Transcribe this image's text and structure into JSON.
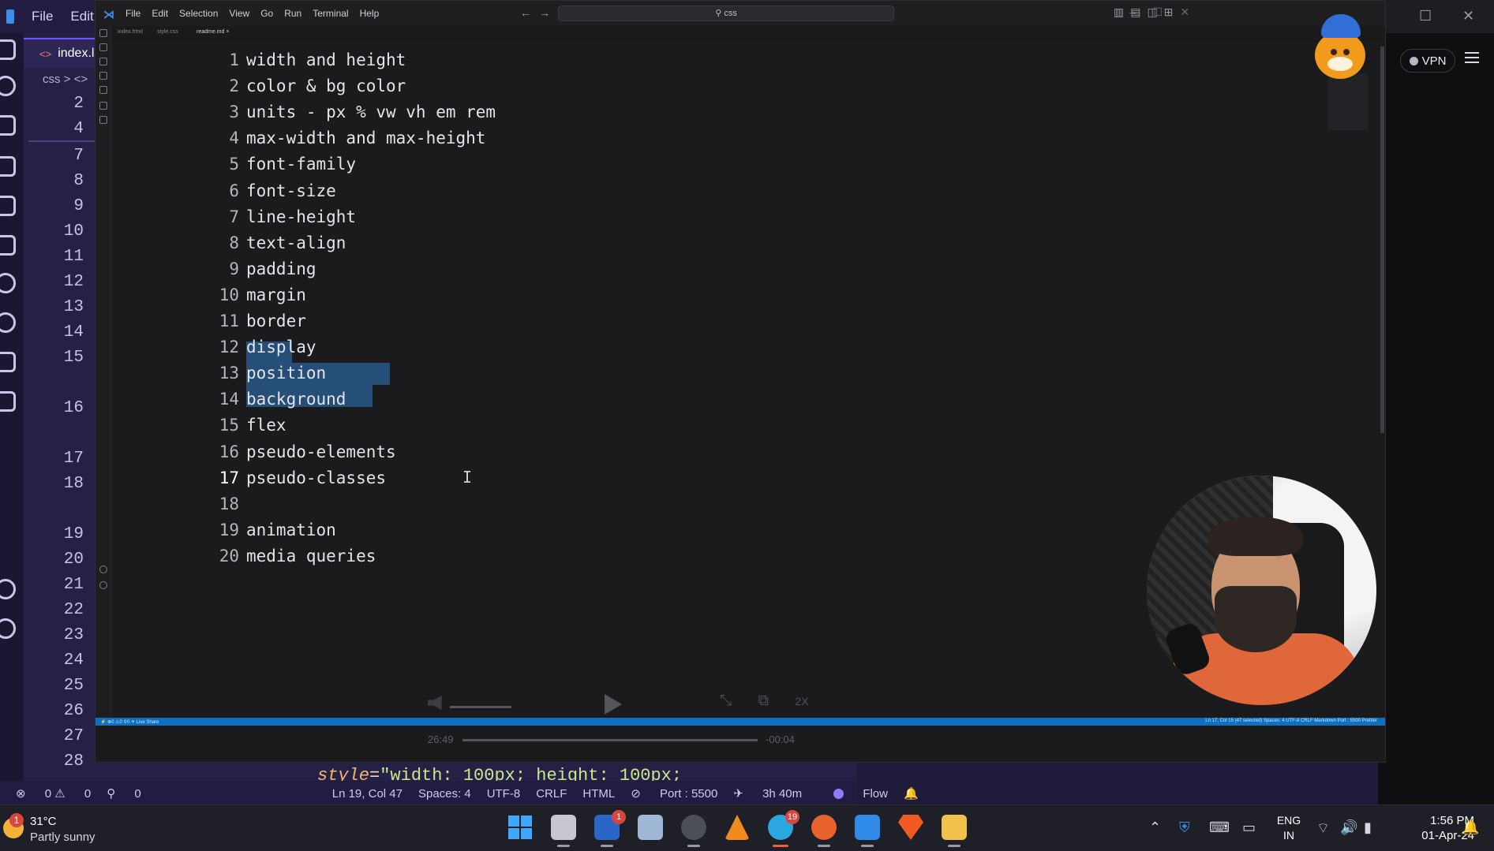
{
  "outer_app": {
    "menu": [
      "File",
      "Edit"
    ],
    "tab_label": "index.l",
    "breadcrumb": "css > <>",
    "line_numbers": [
      "2",
      "4",
      "7",
      "8",
      "9",
      "10",
      "11",
      "12",
      "13",
      "14",
      "15",
      "16",
      "17",
      "18",
      "19",
      "20",
      "21",
      "22",
      "23",
      "24",
      "25",
      "26",
      "27",
      "28"
    ],
    "code_line": {
      "attr": "style",
      "eq": "=",
      "value": "\"width: 100px; height: 100px;"
    },
    "vpn_label": "VPN",
    "status": {
      "errors": "0",
      "warnings": "0",
      "ports": "0",
      "cursor": "Ln 19, Col 47",
      "spaces": "Spaces: 4",
      "encoding": "UTF-8",
      "eol": "CRLF",
      "language": "HTML",
      "port": "Port : 5500",
      "time": "3h 40m",
      "flow": "Flow"
    }
  },
  "inner_window": {
    "menu": [
      "File",
      "Edit",
      "Selection",
      "View",
      "Go",
      "Run",
      "Terminal",
      "Help"
    ],
    "search_text": "css",
    "editor_lines": [
      {
        "n": "1",
        "text": "width and height"
      },
      {
        "n": "2",
        "text": "color & bg color"
      },
      {
        "n": "3",
        "text": "units - px % vw vh em rem"
      },
      {
        "n": "4",
        "text": "max-width and max-height"
      },
      {
        "n": "5",
        "text": "font-family"
      },
      {
        "n": "6",
        "text": "font-size"
      },
      {
        "n": "7",
        "text": "line-height"
      },
      {
        "n": "8",
        "text": "text-align"
      },
      {
        "n": "9",
        "text": "padding"
      },
      {
        "n": "10",
        "text": "margin"
      },
      {
        "n": "11",
        "text": "border"
      },
      {
        "n": "12",
        "text": "display"
      },
      {
        "n": "13",
        "text": "position"
      },
      {
        "n": "14",
        "text": "background"
      },
      {
        "n": "15",
        "text": "flex"
      },
      {
        "n": "16",
        "text": "pseudo-elements"
      },
      {
        "n": "17",
        "text": "pseudo-classes"
      },
      {
        "n": "18",
        "text": ""
      },
      {
        "n": "19",
        "text": "animation"
      },
      {
        "n": "20",
        "text": "media queries"
      }
    ],
    "selected_lines": [
      "15",
      "16",
      "17"
    ],
    "current_line": "17"
  },
  "player": {
    "elapsed": "26:49",
    "remaining": "-00:04",
    "quality": "2X"
  },
  "taskbar": {
    "weather_temp": "31°C",
    "weather_cond": "Partly sunny",
    "weather_badge": "1",
    "todo_badge": "1",
    "telegram_badge": "19",
    "lang_top": "ENG",
    "lang_bottom": "IN",
    "time": "1:56 PM",
    "date": "01-Apr-24"
  },
  "colors": {
    "outer_bg": "#262047",
    "selection": "#264f78",
    "inner_status": "#0e70c0",
    "accent_yellow": "#f2c500"
  }
}
